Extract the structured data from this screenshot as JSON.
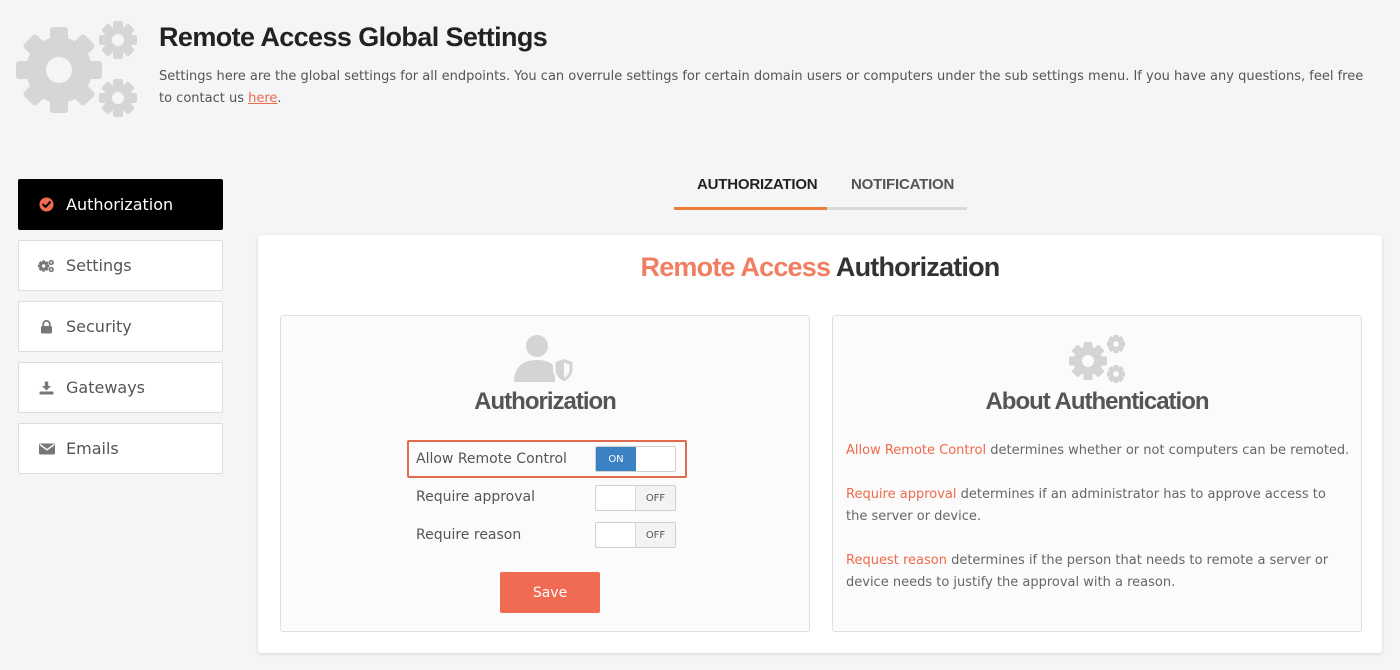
{
  "header": {
    "title": "Remote Access Global Settings",
    "description": "Settings here are the global settings for all endpoints. You can overrule settings for certain domain users or computers under the sub settings menu. If you have any questions, feel free to contact us ",
    "link_text": "here",
    "description_end": ".",
    "icon": "gears-icon"
  },
  "sidebar": {
    "items": [
      {
        "label": "Authorization",
        "icon": "check-circle-icon",
        "active": true
      },
      {
        "label": "Settings",
        "icon": "cogs-icon",
        "active": false
      },
      {
        "label": "Security",
        "icon": "lock-icon",
        "active": false
      },
      {
        "label": "Gateways",
        "icon": "download-icon",
        "active": false
      },
      {
        "label": "Emails",
        "icon": "envelope-icon",
        "active": false
      }
    ]
  },
  "tabs": [
    {
      "label": "AUTHORIZATION",
      "active": true
    },
    {
      "label": "NOTIFICATION",
      "active": false
    }
  ],
  "main": {
    "title_accent": "Remote Access",
    "title_rest": " Authorization",
    "auth_panel": {
      "title": "Authorization",
      "icon": "user-shield-icon",
      "settings": [
        {
          "label": "Allow Remote Control",
          "state": "ON"
        },
        {
          "label": "Require approval",
          "state": "OFF"
        },
        {
          "label": "Require reason",
          "state": "OFF"
        }
      ],
      "save_label": "Save"
    },
    "about_panel": {
      "title": "About Authentication",
      "icon": "gears-icon",
      "paragraphs": [
        {
          "term": "Allow Remote Control",
          "text": " determines whether or not computers can be remoted."
        },
        {
          "term": "Require approval",
          "text": " determines if an administrator has to approve access to the server or device."
        },
        {
          "term": "Request reason",
          "text": " determines if the person that needs to remote a server or device needs to justify the approval with a reason."
        }
      ]
    }
  },
  "colors": {
    "accent": "#f06b52",
    "toggle_on": "#3a82c4",
    "tab_underline": "#ee7b3a",
    "active_nav": "#000000"
  }
}
